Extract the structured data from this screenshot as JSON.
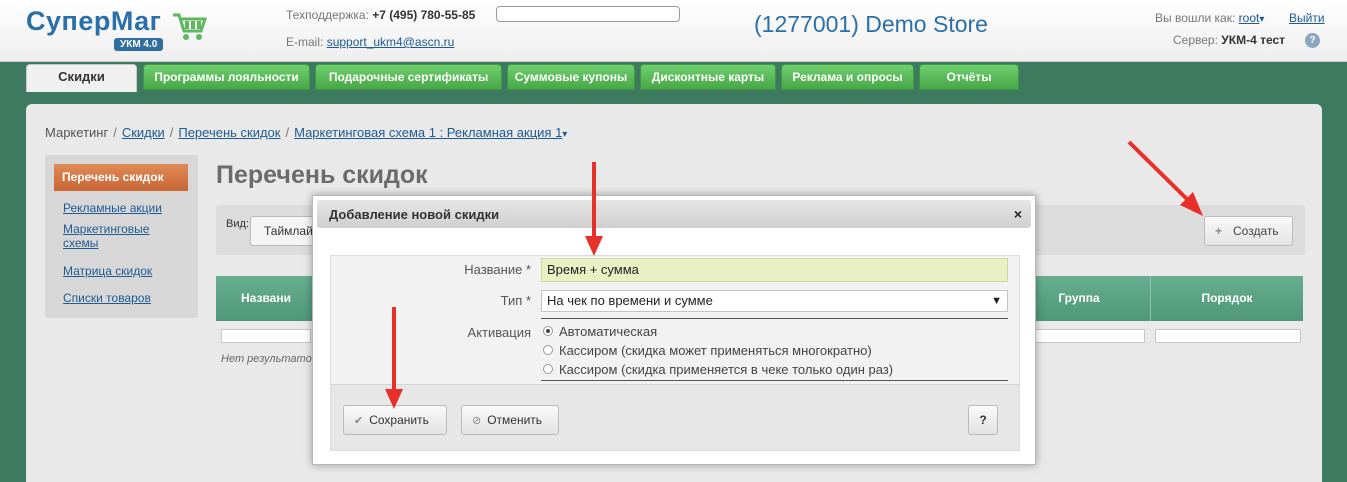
{
  "header": {
    "logo_text": "СуперМаг",
    "logo_badge": "УКМ 4.0",
    "support_label": "Техподдержка:",
    "support_phone": "+7 (495) 780-55-85",
    "email_label": "E-mail:",
    "email_value": "support_ukm4@ascn.ru",
    "search_value": "",
    "store_name": "(1277001) Demo Store",
    "login_label": "Вы вошли как:",
    "login_user": "root",
    "logout": "Выйти",
    "server_label": "Сервер:",
    "server_value": "УКМ-4 тест",
    "help_icon": "?"
  },
  "nav": {
    "tabs": [
      {
        "label": "Скидки"
      },
      {
        "label": "Программы лояльности"
      },
      {
        "label": "Подарочные сертификаты"
      },
      {
        "label": "Суммовые купоны"
      },
      {
        "label": "Дисконтные карты"
      },
      {
        "label": "Реклама и опросы"
      },
      {
        "label": "Отчёты"
      }
    ]
  },
  "breadcrumb": {
    "items": [
      "Маркетинг",
      "Скидки",
      "Перечень скидок",
      "Маркетинговая схема 1 : Рекламная акция 1"
    ],
    "sep": "/",
    "caret": "▾"
  },
  "sidebar": {
    "items": [
      {
        "label": "Перечень скидок"
      },
      {
        "label": "Рекламные акции"
      },
      {
        "label": "Маркетинговые схемы"
      },
      {
        "label": "Матрица скидок"
      },
      {
        "label": "Списки товаров"
      }
    ]
  },
  "main": {
    "title": "Перечень скидок",
    "filter_label": "Вид:",
    "filter_value": "Таймлай",
    "create_label": "Создать",
    "create_icon": "+",
    "columns": [
      "Названи",
      "Группа",
      "Порядок"
    ],
    "no_results": "Нет результатов."
  },
  "modal": {
    "title": "Добавление новой скидки",
    "close": "×",
    "name_label": "Название *",
    "name_value": "Время + сумма",
    "type_label": "Тип *",
    "type_value": "На чек по времени и сумме",
    "type_arrow": "▼",
    "activation_label": "Активация",
    "activation_options": [
      {
        "label": "Автоматическая",
        "selected": true
      },
      {
        "label": "Кассиром (скидка может применяться многократно)",
        "selected": false
      },
      {
        "label": "Кассиром (скидка применяется в чеке только один раз)",
        "selected": false
      }
    ],
    "save_label": "Сохранить",
    "save_icon": "✔",
    "cancel_label": "Отменить",
    "cancel_icon": "⊘",
    "help_label": "?"
  },
  "colors": {
    "brand_blue": "#2b6fa8",
    "nav_green": "#48a848",
    "page_green": "#3d7a5f",
    "table_green": "#5a9f82",
    "accent_orange": "#c86634",
    "annotation_red": "#e8302a"
  }
}
